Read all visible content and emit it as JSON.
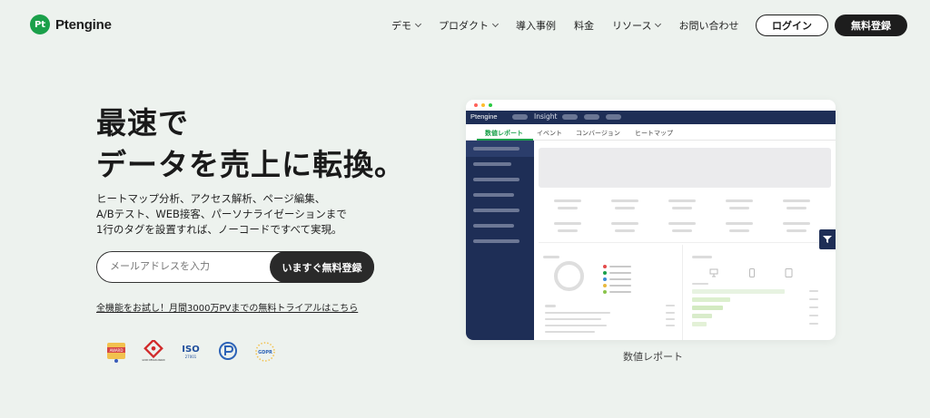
{
  "header": {
    "logo_mark": "Pt",
    "logo_text": "Ptengine",
    "nav": [
      {
        "label": "デモ",
        "dropdown": true
      },
      {
        "label": "プロダクト",
        "dropdown": true
      },
      {
        "label": "導入事例",
        "dropdown": false
      },
      {
        "label": "料金",
        "dropdown": false
      },
      {
        "label": "リソース",
        "dropdown": true
      },
      {
        "label": "お問い合わせ",
        "dropdown": false
      }
    ],
    "login_label": "ログイン",
    "signup_label": "無料登録"
  },
  "hero": {
    "headline_line1": "最速で",
    "headline_line2": "データを売上に転換。",
    "desc_line1": "ヒートマップ分析、アクセス解析、ページ編集、",
    "desc_line2": "A/Bテスト、WEB接客、パーソナライゼーションまで",
    "desc_line3": "1行のタグを設置すれば、ノーコードですべて実現。",
    "email_placeholder": "メールアドレスを入力",
    "trial_button": "いますぐ無料登録",
    "trial_link": "全機能をお試し！月間3000万PVまでの無料トライアルはこちら",
    "badges": [
      "award-badge-icon",
      "good-design-award-icon",
      "iso-27001-icon",
      "privacy-mark-icon",
      "gdpr-icon"
    ],
    "badge_texts": [
      "AWARD",
      "GOOD DESIGN AWARD",
      "ISO",
      "27001",
      "GDPR"
    ]
  },
  "mockup": {
    "brand": "Ptengine",
    "insight_label": "Insight",
    "tabs": [
      "数値レポート",
      "イベント",
      "コンバージョン",
      "ヒートマップ"
    ],
    "active_tab": "数値レポート",
    "caption": "数値レポート"
  },
  "colors": {
    "background": "#edf2ee",
    "brand_green": "#1aa04a",
    "navy": "#1e2e56",
    "dark": "#1d1d1d"
  }
}
